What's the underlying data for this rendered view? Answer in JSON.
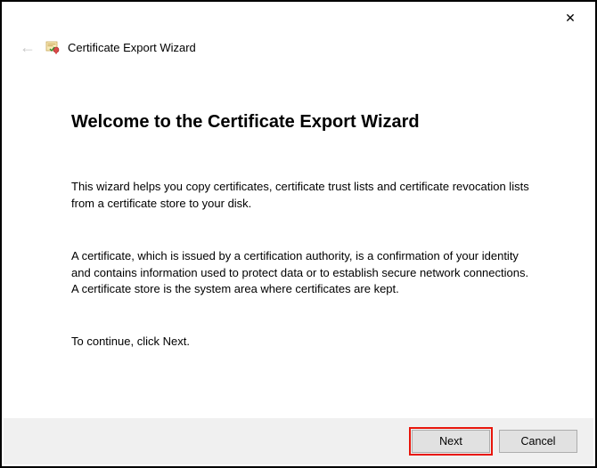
{
  "titlebar": {
    "close": "✕"
  },
  "header": {
    "back_arrow": "←",
    "title": "Certificate Export Wizard"
  },
  "content": {
    "heading": "Welcome to the Certificate Export Wizard",
    "para1": "This wizard helps you copy certificates, certificate trust lists and certificate revocation lists from a certificate store to your disk.",
    "para2": "A certificate, which is issued by a certification authority, is a confirmation of your identity and contains information used to protect data or to establish secure network connections. A certificate store is the system area where certificates are kept.",
    "para3": "To continue, click Next."
  },
  "footer": {
    "next": "Next",
    "cancel": "Cancel"
  }
}
